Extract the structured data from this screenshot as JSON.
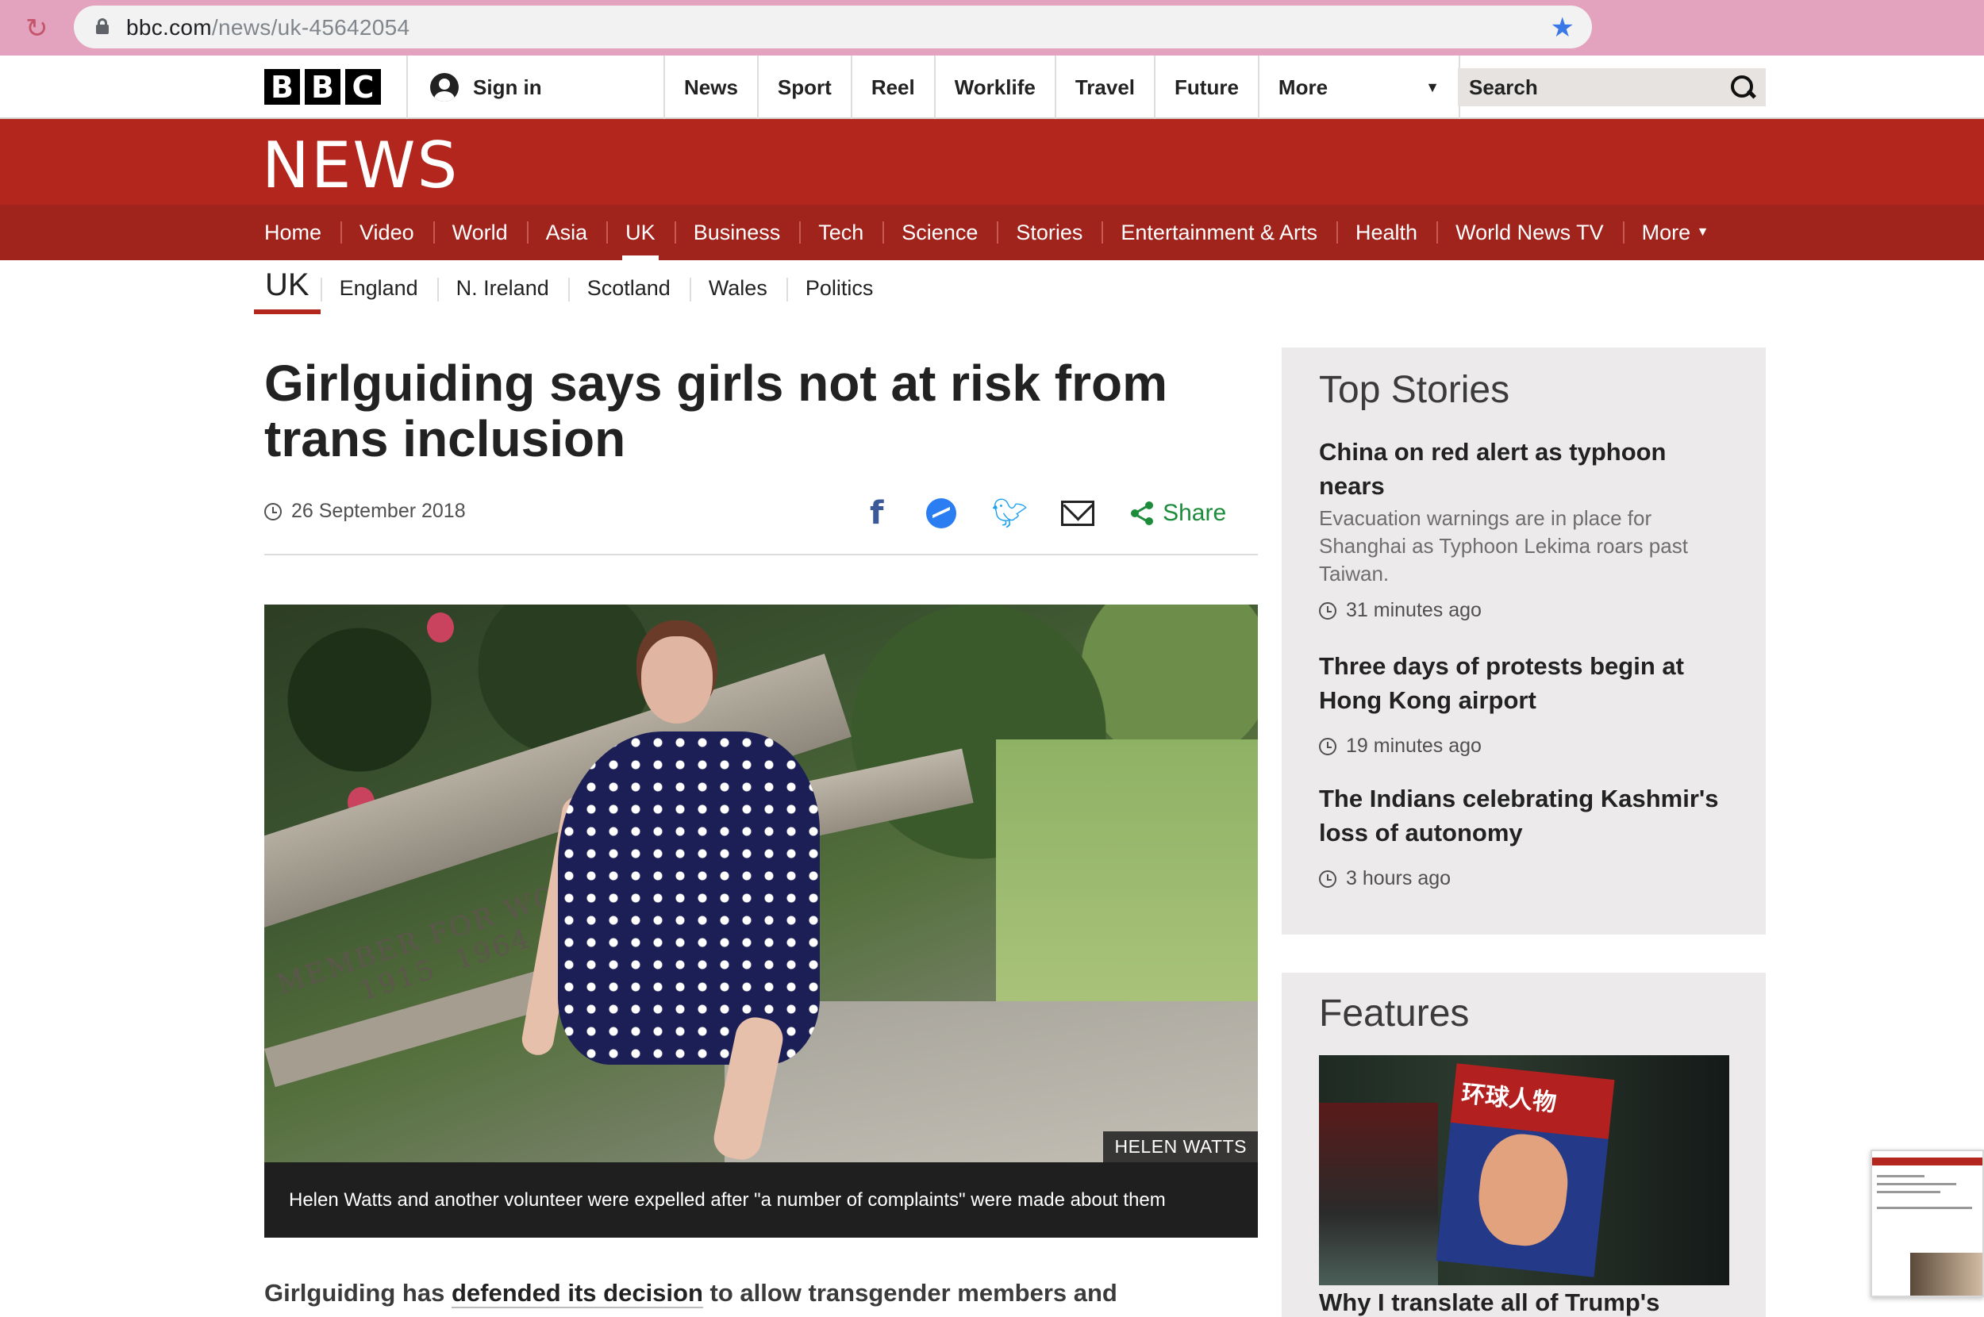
{
  "browser": {
    "url_host": "bbc.com",
    "url_path": "/news/uk-45642054"
  },
  "topbar": {
    "logo_letters": [
      "B",
      "B",
      "C"
    ],
    "sign_in": "Sign in",
    "nav": [
      "News",
      "Sport",
      "Reel",
      "Worklife",
      "Travel",
      "Future"
    ],
    "more": "More",
    "search_placeholder": "Search"
  },
  "masthead": {
    "title": "NEWS",
    "color": "#b3261e"
  },
  "section_nav": {
    "items": [
      "Home",
      "Video",
      "World",
      "Asia",
      "UK",
      "Business",
      "Tech",
      "Science",
      "Stories",
      "Entertainment & Arts",
      "Health",
      "World News TV"
    ],
    "more": "More",
    "active": "UK"
  },
  "sub_nav": {
    "current": "UK",
    "items": [
      "England",
      "N. Ireland",
      "Scotland",
      "Wales",
      "Politics"
    ]
  },
  "article": {
    "headline_line1": "Girlguiding says girls not at risk from",
    "headline_line2": "trans inclusion",
    "date": "26 September 2018",
    "share_label": "Share",
    "image_credit": "HELEN WATTS",
    "image_carving_line1": "MEMBER FOR WOODFORD",
    "image_carving_line2": "1915  1964",
    "caption": "Helen Watts and another volunteer were expelled after \"a number of complaints\" were made about them",
    "body_start": "Girlguiding has ",
    "body_link": "defended its decision",
    "body_end": " to allow transgender members and"
  },
  "top_stories": {
    "heading": "Top Stories",
    "items": [
      {
        "title_line1": "China on red alert as typhoon",
        "title_line2": "nears",
        "summary_line1": "Evacuation warnings are in place for",
        "summary_line2": "Shanghai as Typhoon Lekima roars past",
        "summary_line3": "Taiwan.",
        "time": "31 minutes ago"
      },
      {
        "title_line1": "Three days of protests begin at",
        "title_line2": "Hong Kong airport",
        "time": "19 minutes ago"
      },
      {
        "title_line1": "The Indians celebrating Kashmir's",
        "title_line2": "loss of autonomy",
        "time": "3 hours ago"
      }
    ]
  },
  "features": {
    "heading": "Features",
    "image_text": "环球人物",
    "first_title": "Why I translate all of Trump's"
  }
}
